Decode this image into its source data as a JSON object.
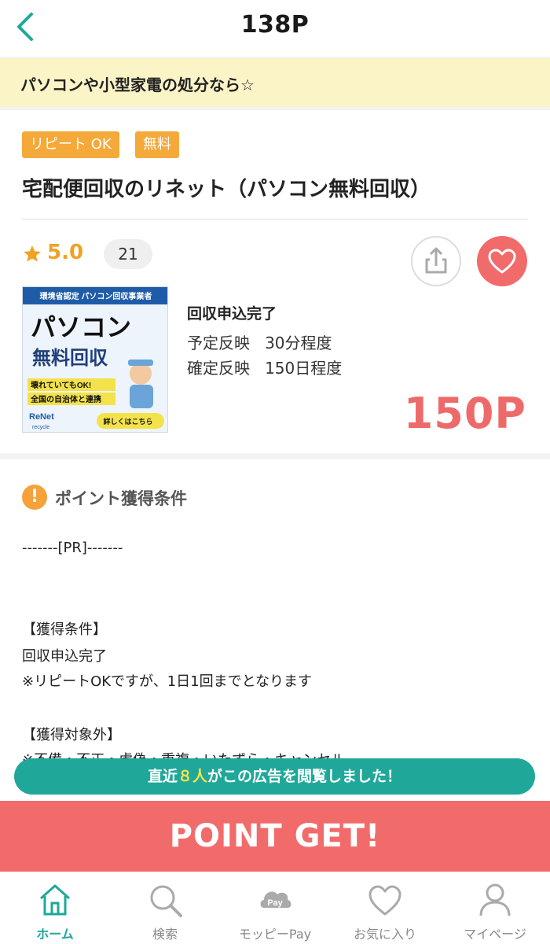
{
  "header": {
    "title": "138P"
  },
  "banner": {
    "text": "パソコンや小型家電の処分なら☆"
  },
  "offer": {
    "tags": [
      "リピート OK",
      "無料"
    ],
    "title": "宅配便回収のリネット（パソコン無料回収）",
    "rating": "5.0",
    "review_count": "21",
    "condition_title": "回収申込完了",
    "scheduled_label": "予定反映",
    "scheduled_value": "30分程度",
    "confirmed_label": "確定反映",
    "confirmed_value": "150日程度",
    "points": "150P"
  },
  "ad_image": {
    "top_text": "環境省認定 パソコン回収事業者",
    "headline1": "パソコン",
    "headline2": "無料回収",
    "line1": "壊れていてもOK!",
    "line2": "全国の自治体と連携",
    "brand": "ReNet",
    "brand_sub": "recycle",
    "cta": "詳しくはこちら"
  },
  "conditions_section": {
    "title": "ポイント獲得条件",
    "pr_line": "-------[PR]-------",
    "cond_heading": "【獲得条件】",
    "cond_line1": "回収申込完了",
    "cond_line2": "※リピートOKですが、1日1回までとなります",
    "excluded_heading": "【獲得対象外】",
    "excluded_line1": "※不備・不正・虚偽・重複・いたずら・キャンセル"
  },
  "viewers": {
    "prefix": "直近",
    "count": "８人",
    "suffix": "がこの広告を閲覧しました！"
  },
  "cta": {
    "label": "POINT GET!"
  },
  "tabs": [
    {
      "label": "ホーム",
      "icon": "home-icon"
    },
    {
      "label": "検索",
      "icon": "search-icon"
    },
    {
      "label": "モッピーPay",
      "icon": "pay-icon"
    },
    {
      "label": "お気に入り",
      "icon": "heart-icon"
    },
    {
      "label": "マイページ",
      "icon": "user-icon"
    }
  ],
  "colors": {
    "accent_teal": "#1fa89a",
    "point_red": "#f26b6b",
    "tag_orange": "#f5a93a",
    "banner_yellow": "#fbf4c7",
    "star_gold": "#f0a224"
  }
}
